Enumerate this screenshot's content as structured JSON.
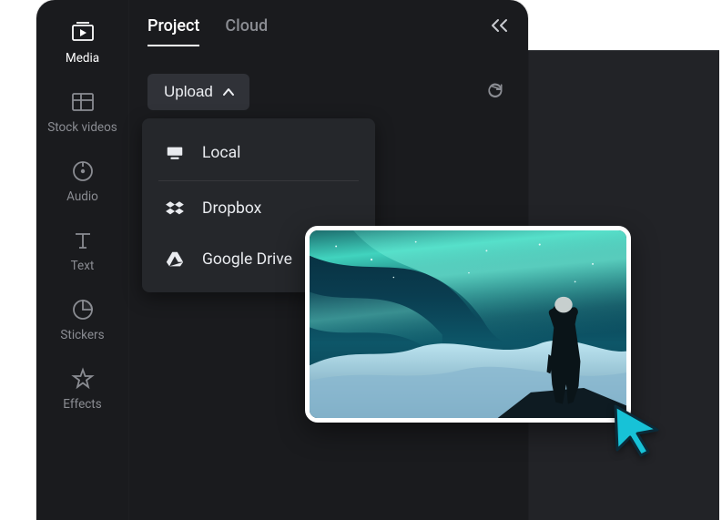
{
  "rail": {
    "items": [
      {
        "label": "Media"
      },
      {
        "label": "Stock videos"
      },
      {
        "label": "Audio"
      },
      {
        "label": "Text"
      },
      {
        "label": "Stickers"
      },
      {
        "label": "Effects"
      }
    ]
  },
  "tabs": {
    "project": "Project",
    "cloud": "Cloud"
  },
  "toolbar": {
    "upload_label": "Upload"
  },
  "dropdown": {
    "options": [
      {
        "label": "Local"
      },
      {
        "label": "Dropbox"
      },
      {
        "label": "Google Drive"
      }
    ]
  }
}
